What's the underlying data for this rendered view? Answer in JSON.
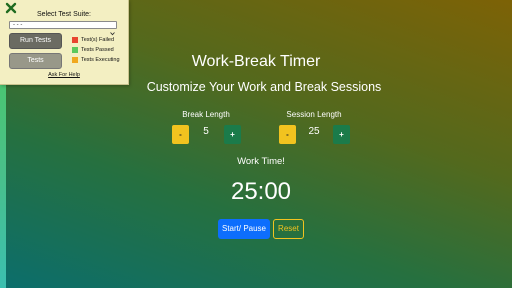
{
  "test_panel": {
    "close_icon": "close-x-icon",
    "title": "Select Test Suite:",
    "select_value": "- - -",
    "run_button": "Run Tests",
    "tests_button": "Tests",
    "legend": [
      {
        "label": "Test(s) Failed",
        "color": "#e8452f"
      },
      {
        "label": "Tests Passed",
        "color": "#5cc95c"
      },
      {
        "label": "Tests Executing",
        "color": "#f0a81e"
      }
    ],
    "help_link": "Ask For Help"
  },
  "app": {
    "title": "Work-Break Timer",
    "subtitle": "Customize Your Work and Break Sessions",
    "break": {
      "label": "Break Length",
      "value": "5",
      "dec_label": "-",
      "inc_label": "+"
    },
    "session": {
      "label": "Session Length",
      "value": "25",
      "dec_label": "-",
      "inc_label": "+"
    },
    "timer_label": "Work Time!",
    "timer_value": "25:00",
    "start_button": "Start/ Pause",
    "reset_button": "Reset"
  },
  "colors": {
    "decrement": "#f2c31f",
    "increment": "#1b7b4a",
    "primary": "#0d6efd",
    "panel_bg": "#f3efc2",
    "close_icon": "#1f6b1f"
  }
}
